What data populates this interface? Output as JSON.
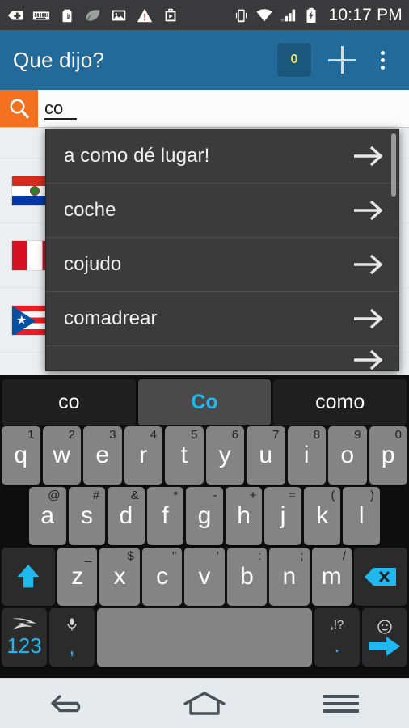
{
  "status_bar": {
    "time": "10:17 PM",
    "left_icons": [
      "tag-plus-icon",
      "keyboard-icon",
      "usb-battery-icon",
      "leaf-icon",
      "image-icon",
      "warning-icon",
      "briefcase-icon"
    ],
    "right_icons": [
      "vibrate-icon",
      "wifi-icon",
      "signal-icon",
      "battery-charging-icon"
    ]
  },
  "app_bar": {
    "title": "Que dijo?",
    "badge_count": "0",
    "add_icon": "plus-icon",
    "overflow_icon": "more-vertical-icon",
    "background": "#216a99",
    "badge_color": "#f2e04a"
  },
  "search": {
    "icon": "search-icon",
    "value": "co",
    "placeholder": "",
    "icon_background": "#f4711f"
  },
  "suggestion_dropdown": {
    "items": [
      {
        "label": "a como dé lugar!",
        "arrow_icon": "arrow-right-icon"
      },
      {
        "label": "coche",
        "arrow_icon": "arrow-right-icon"
      },
      {
        "label": "cojudo",
        "arrow_icon": "arrow-right-icon"
      },
      {
        "label": "comadrear",
        "arrow_icon": "arrow-right-icon"
      },
      {
        "label": "",
        "arrow_icon": "arrow-right-icon"
      }
    ],
    "background": "#3b3b3b"
  },
  "country_list": {
    "rows": [
      {
        "flag": "paraguay-flag"
      },
      {
        "flag": "peru-flag"
      },
      {
        "flag": "puerto-rico-flag"
      }
    ]
  },
  "keyboard": {
    "suggestions": [
      {
        "text": "co",
        "active": false
      },
      {
        "text": "Co",
        "active": true
      },
      {
        "text": "como",
        "active": false
      }
    ],
    "row1": [
      {
        "key": "q",
        "sec": "1"
      },
      {
        "key": "w",
        "sec": "2"
      },
      {
        "key": "e",
        "sec": "3"
      },
      {
        "key": "r",
        "sec": "4"
      },
      {
        "key": "t",
        "sec": "5"
      },
      {
        "key": "y",
        "sec": "6"
      },
      {
        "key": "u",
        "sec": "7"
      },
      {
        "key": "i",
        "sec": "8"
      },
      {
        "key": "o",
        "sec": "9"
      },
      {
        "key": "p",
        "sec": "0"
      }
    ],
    "row2": [
      {
        "key": "a",
        "sec": "@"
      },
      {
        "key": "s",
        "sec": "#"
      },
      {
        "key": "d",
        "sec": "&"
      },
      {
        "key": "f",
        "sec": "*"
      },
      {
        "key": "g",
        "sec": "-"
      },
      {
        "key": "h",
        "sec": "+"
      },
      {
        "key": "j",
        "sec": "="
      },
      {
        "key": "k",
        "sec": "("
      },
      {
        "key": "l",
        "sec": ")"
      }
    ],
    "row3": [
      {
        "key": "z",
        "sec": "_"
      },
      {
        "key": "x",
        "sec": "$"
      },
      {
        "key": "c",
        "sec": "\""
      },
      {
        "key": "v",
        "sec": "'"
      },
      {
        "key": "b",
        "sec": ":"
      },
      {
        "key": "n",
        "sec": ";"
      },
      {
        "key": "m",
        "sec": "/"
      }
    ],
    "shift_icon": "shift-up-icon",
    "backspace_icon": "backspace-icon",
    "row4": {
      "numeric_label": "123",
      "swiftkey_icon": "swiftkey-logo-icon",
      "mic_icon": "microphone-icon",
      "comma_label": ",",
      "space_label": "",
      "punct_top_label": ",!?",
      "period_label": ".",
      "emoji_icon": "smiley-icon",
      "enter_icon": "arrow-right-enter-icon"
    },
    "accent_color": "#21b7ef"
  },
  "nav_bar": {
    "back_icon": "back-icon",
    "home_icon": "home-icon",
    "menu_icon": "menu-icon"
  }
}
